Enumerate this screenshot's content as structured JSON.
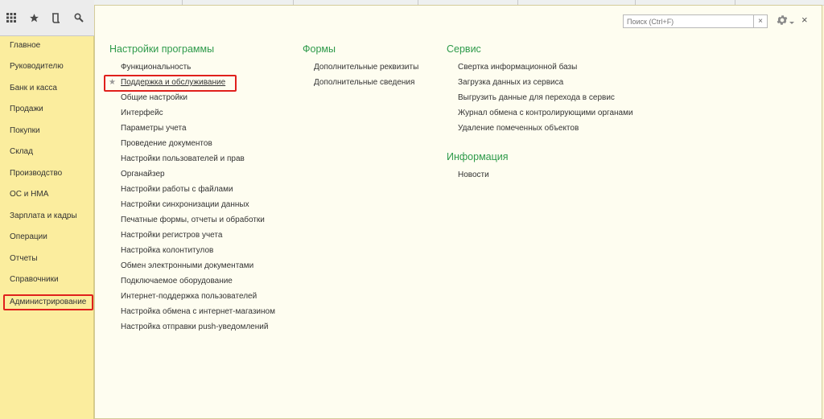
{
  "toolbar": {
    "icons": [
      "apps-grid-icon",
      "star-icon",
      "history-icon",
      "search-icon"
    ]
  },
  "sidebar": {
    "items": [
      {
        "label": "Главное"
      },
      {
        "label": "Руководителю"
      },
      {
        "label": "Банк и касса"
      },
      {
        "label": "Продажи"
      },
      {
        "label": "Покупки"
      },
      {
        "label": "Склад"
      },
      {
        "label": "Производство"
      },
      {
        "label": "ОС и НМА"
      },
      {
        "label": "Зарплата и кадры"
      },
      {
        "label": "Операции"
      },
      {
        "label": "Отчеты"
      },
      {
        "label": "Справочники"
      },
      {
        "label": "Администрирование",
        "active": true
      }
    ]
  },
  "search": {
    "placeholder": "Поиск (Ctrl+F)",
    "value": "",
    "clear_label": "×"
  },
  "panel": {
    "close_label": "×"
  },
  "sections": {
    "settings": {
      "title": "Настройки программы",
      "items": [
        "Функциональность",
        "Поддержка и обслуживание",
        "Общие настройки",
        "Интерфейс",
        "Параметры учета",
        "Проведение документов",
        "Настройки пользователей и прав",
        "Органайзер",
        "Настройки работы с файлами",
        "Настройки синхронизации данных",
        "Печатные формы, отчеты и обработки",
        "Настройки регистров учета",
        "Настройка колонтитулов",
        "Обмен электронными документами",
        "Подключаемое оборудование",
        "Интернет-поддержка пользователей",
        "Настройка обмена с интернет-магазином",
        "Настройка отправки push-уведомлений"
      ],
      "favorite_star": "★"
    },
    "forms": {
      "title": "Формы",
      "items": [
        "Дополнительные реквизиты",
        "Дополнительные сведения"
      ]
    },
    "service": {
      "title": "Сервис",
      "items": [
        "Свертка информационной базы",
        "Загрузка данных из сервиса",
        "Выгрузить данные для перехода в сервис",
        "Журнал обмена с контролирующими органами",
        "Удаление помеченных объектов"
      ]
    },
    "info": {
      "title": "Информация",
      "items": [
        "Новости"
      ]
    }
  },
  "colors": {
    "section_title": "#2d9a4a",
    "sidebar_bg": "#fbed9e",
    "panel_bg": "#fefdf0",
    "highlight": "#e0201c"
  }
}
